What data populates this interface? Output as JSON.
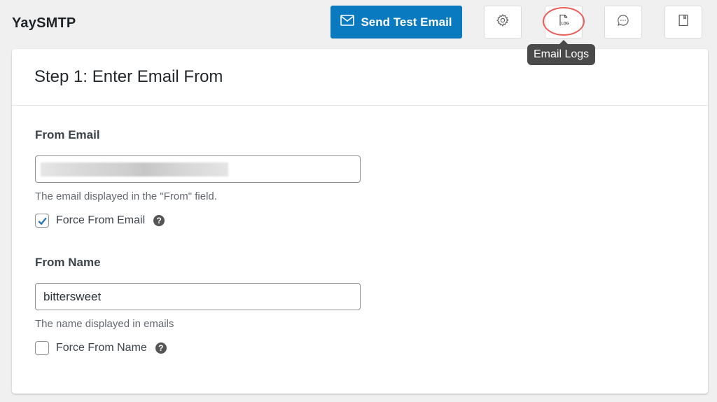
{
  "header": {
    "app_title": "YaySMTP",
    "send_test_email_label": "Send Test Email",
    "icon_buttons": [
      {
        "name": "settings",
        "icon": "gear-icon"
      },
      {
        "name": "email-logs",
        "icon": "log-file-icon",
        "icon_text": "LOG",
        "tooltip": "Email Logs",
        "highlighted": true
      },
      {
        "name": "support-chat",
        "icon": "chat-bubble-icon"
      },
      {
        "name": "documentation",
        "icon": "book-icon"
      }
    ]
  },
  "card": {
    "title": "Step 1: Enter Email From",
    "from_email": {
      "label": "From Email",
      "value_redacted": true,
      "help": "The email displayed in the \"From\" field.",
      "force_label": "Force From Email",
      "force_checked": true
    },
    "from_name": {
      "label": "From Name",
      "value": "bittersweet",
      "help": "The name displayed in emails",
      "force_label": "Force From Name",
      "force_checked": false
    }
  },
  "colors": {
    "primary": "#0a7ac0",
    "highlight_ring": "#ec5d57",
    "checkbox_check": "#2271b1",
    "tooltip_bg": "#4a4a4a"
  }
}
